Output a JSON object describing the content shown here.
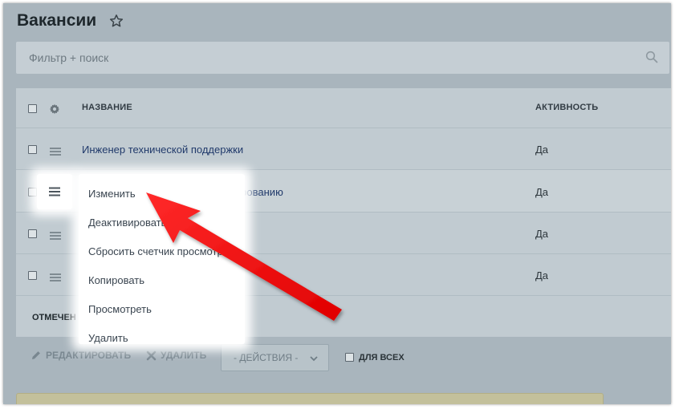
{
  "page": {
    "title": "Вакансии"
  },
  "search": {
    "placeholder": "Фильтр + поиск"
  },
  "table": {
    "columns": {
      "name": "НАЗВАНИЕ",
      "activity": "АКТИВНОСТЬ"
    },
    "rows": [
      {
        "name": "Инженер технической поддержки",
        "activity": "Да"
      },
      {
        "name": "…ому тестированию",
        "activity": "Да"
      },
      {
        "name": "",
        "activity": "Да"
      },
      {
        "name": "",
        "activity": "Да"
      }
    ],
    "footer_label": "ОТМЕЧЕН"
  },
  "context_menu": {
    "items": [
      {
        "label": "Изменить"
      },
      {
        "label": "Деактивировать"
      },
      {
        "label": "Сбросить счетчик просмотров"
      },
      {
        "label": "Копировать"
      },
      {
        "label": "Просмотреть"
      },
      {
        "label": "Удалить"
      }
    ]
  },
  "actions": {
    "edit_label": "РЕДАКТИРОВАТЬ",
    "delete_label": "УДАЛИТЬ",
    "actions_select": "- ДЕЙСТВИЯ -",
    "for_all_label": "ДЛЯ ВСЕХ"
  },
  "colors": {
    "overlay_background": "#a9b5bd",
    "link": "#213a6b",
    "arrow": "#ff1a1a"
  },
  "icons": [
    "star-icon",
    "search-icon",
    "gear-icon",
    "burger-menu-icon",
    "pencil-icon",
    "close-icon",
    "chevron-down-icon",
    "arrow-annotation"
  ]
}
